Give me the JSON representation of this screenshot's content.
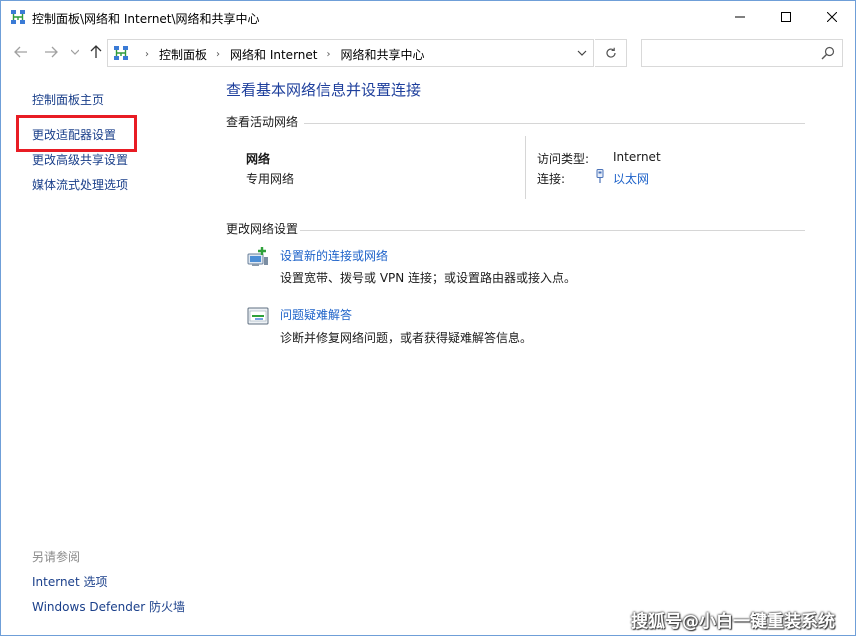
{
  "window": {
    "title": "控制面板\\网络和 Internet\\网络和共享中心"
  },
  "address_bar": {
    "crumbs": [
      "控制面板",
      "网络和 Internet",
      "网络和共享中心"
    ],
    "search_placeholder": ""
  },
  "left_panel": {
    "home": "控制面板主页",
    "change_adapter": "更改适配器设置",
    "change_advanced": "更改高级共享设置",
    "media_streaming": "媒体流式处理选项",
    "see_also": "另请参阅",
    "internet_options": "Internet 选项",
    "defender_firewall": "Windows Defender 防火墙"
  },
  "main": {
    "title": "查看基本网络信息并设置连接",
    "active_networks_heading": "查看活动网络",
    "network_name": "网络",
    "network_profile": "专用网络",
    "access_type_label": "访问类型:",
    "access_type_value": "Internet",
    "connections_label": "连接:",
    "connection_value": "以太网",
    "change_settings_heading": "更改网络设置",
    "tasks": [
      {
        "title": "设置新的连接或网络",
        "desc": "设置宽带、拨号或 VPN 连接；或设置路由器或接入点。"
      },
      {
        "title": "问题疑难解答",
        "desc": "诊断并修复网络问题，或者获得疑难解答信息。"
      }
    ]
  },
  "watermark": "搜狐号@小白一键重装系统",
  "colors": {
    "link": "#1d62c9",
    "title": "#1e3f9c",
    "highlight": "#e81c24"
  }
}
